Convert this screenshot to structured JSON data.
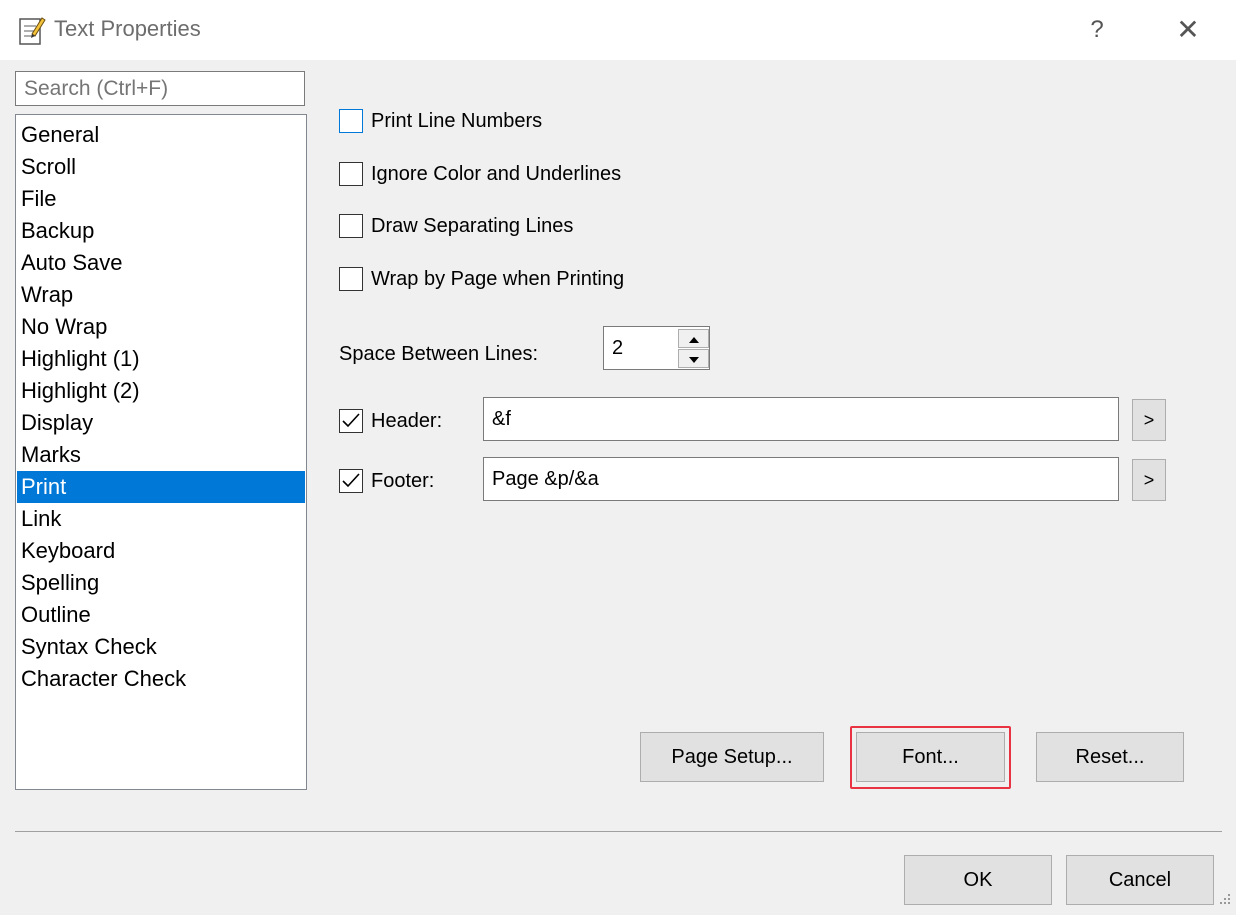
{
  "window": {
    "title": "Text Properties",
    "help_label": "?",
    "close_label": "✕",
    "title_icon": "notepad-icon"
  },
  "sidebar": {
    "search_placeholder": "Search (Ctrl+F)",
    "items": [
      {
        "label": "General"
      },
      {
        "label": "Scroll"
      },
      {
        "label": "File"
      },
      {
        "label": "Backup"
      },
      {
        "label": "Auto Save"
      },
      {
        "label": "Wrap"
      },
      {
        "label": "No Wrap"
      },
      {
        "label": "Highlight (1)"
      },
      {
        "label": "Highlight (2)"
      },
      {
        "label": "Display"
      },
      {
        "label": "Marks"
      },
      {
        "label": "Print"
      },
      {
        "label": "Link"
      },
      {
        "label": "Keyboard"
      },
      {
        "label": "Spelling"
      },
      {
        "label": "Outline"
      },
      {
        "label": "Syntax Check"
      },
      {
        "label": "Character Check"
      }
    ],
    "selected": "Print"
  },
  "print": {
    "print_line_numbers": {
      "label": "Print Line Numbers",
      "checked": false
    },
    "ignore_color": {
      "label": "Ignore Color and Underlines",
      "checked": false
    },
    "draw_separating": {
      "label": "Draw Separating Lines",
      "checked": false
    },
    "wrap_by_page": {
      "label": "Wrap by Page when Printing",
      "checked": false
    },
    "space_between_lines": {
      "label": "Space Between Lines:",
      "value": "2"
    },
    "header": {
      "label": "Header:",
      "checked": true,
      "value": "&f",
      "insert_label": ">"
    },
    "footer": {
      "label": "Footer:",
      "checked": true,
      "value": "Page &p/&a",
      "insert_label": ">"
    },
    "page_setup_label": "Page Setup...",
    "font_label": "Font...",
    "reset_label": "Reset..."
  },
  "footer_buttons": {
    "ok_label": "OK",
    "cancel_label": "Cancel"
  },
  "colors": {
    "selection": "#0078d7",
    "highlight_ring": "#e81123"
  }
}
